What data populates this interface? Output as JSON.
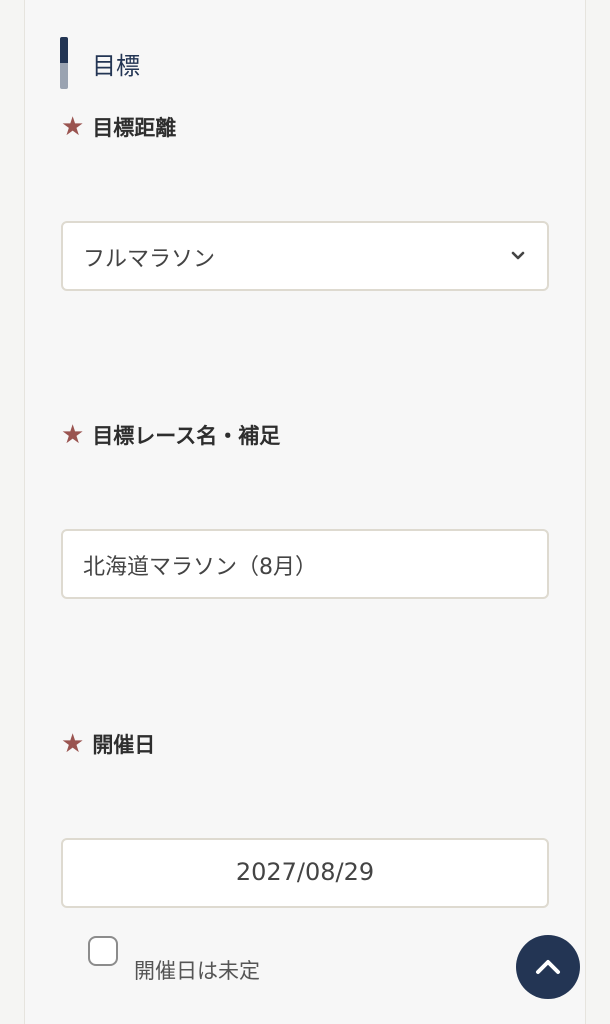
{
  "section": {
    "title": "目標"
  },
  "fields": {
    "distance": {
      "label": "目標距離",
      "value": "フルマラソン"
    },
    "race": {
      "label": "目標レース名・補足",
      "value": "北海道マラソン（8月）"
    },
    "date": {
      "label": "開催日",
      "value": "2027/08/29"
    }
  },
  "undecided": {
    "label": "開催日は未定",
    "checked": false
  },
  "required_mark": "★",
  "colors": {
    "accent": "#233554",
    "star": "#9a5450",
    "border": "#dedad0"
  },
  "icons": {
    "select": "chevron-down-icon",
    "back_to_top": "chevron-up-icon"
  }
}
